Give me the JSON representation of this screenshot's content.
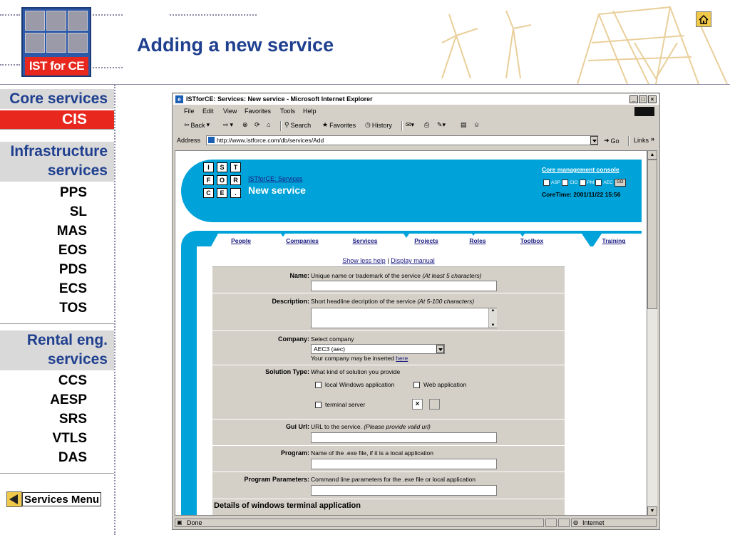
{
  "slide": {
    "logo_text": "IST for CE",
    "title": "Adding a new service",
    "home_icon": "home-icon"
  },
  "nav": {
    "sections": [
      {
        "label": "Core services"
      },
      {
        "label": "CIS"
      },
      {
        "label": "Infrastructure services"
      },
      {
        "label": "Rental eng. services"
      }
    ],
    "infra_items": [
      "PPS",
      "SL",
      "MAS",
      "EOS",
      "PDS",
      "ECS",
      "TOS"
    ],
    "rental_items": [
      "CCS",
      "AESP",
      "SRS",
      "VTLS",
      "DAS"
    ],
    "services_menu": "Services Menu",
    "accent": "#e8281e",
    "heading_color": "#1f3f8f"
  },
  "browser": {
    "title": "ISTforCE: Services: New service - Microsoft Internet Explorer",
    "menus": [
      "File",
      "Edit",
      "View",
      "Favorites",
      "Tools",
      "Help"
    ],
    "toolbar": {
      "back": "Back",
      "search": "Search",
      "favorites": "Favorites",
      "history": "History"
    },
    "address_label": "Address",
    "address_value": "http://www.istforce.com/db/services/Add",
    "go": "Go",
    "links": "Links",
    "status_left": "Done",
    "status_zone": "Internet"
  },
  "page": {
    "brand_letters": [
      "I",
      "S",
      "T",
      "F",
      "O",
      "R",
      "C",
      "E",
      "."
    ],
    "breadcrumb": "ISTforCE: Services",
    "title": "New service",
    "console_link": "Core management console",
    "roles": [
      "ASP",
      "CIO",
      "PM",
      "AEC"
    ],
    "go_button": "GO",
    "core_time": "CoreTime: 2001/11/22 15:56",
    "tabs": [
      "People",
      "Companies",
      "Services",
      "Projects",
      "Roles",
      "Toolbox",
      "Training"
    ],
    "active_tab": "Services",
    "header_color": "#00a3d9"
  },
  "form": {
    "help_link": "Show less help",
    "help_sep": "|",
    "manual_link": "Display manual",
    "name_label": "Name:",
    "name_desc": "Unique name or trademark of the service",
    "name_hint": "(At least 5 characters)",
    "description_label": "Description:",
    "description_desc": "Short headline decription of the service",
    "description_hint": "(At 5-100 characters)",
    "company_label": "Company:",
    "company_desc": "Select company",
    "company_value": "AEC3 (aec)",
    "company_note": "Your company may be inserted",
    "company_note_link": "here",
    "solution_label": "Solution Type:",
    "solution_desc": "What kind of solution you provide",
    "solution_options": [
      "local Windows application",
      "Web application",
      "terminal server"
    ],
    "gui_label": "Gui Url:",
    "gui_desc": "URL to the service.",
    "gui_hint": "(Please provide valid url)",
    "program_label": "Program:",
    "program_desc": "Name of the .exe file, if it is a local application",
    "params_label": "Program Parameters:",
    "params_desc": "Command line parameters for the .exe file or local application",
    "details_heading": "Details of windows terminal application"
  }
}
